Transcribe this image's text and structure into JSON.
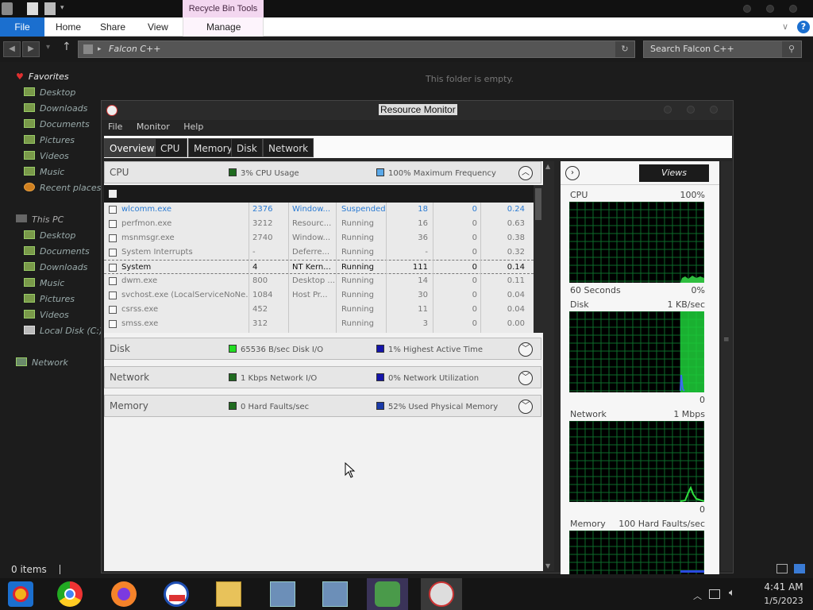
{
  "explorer": {
    "contextual_tab": "Recycle Bin Tools",
    "ribbon": {
      "file": "File",
      "home": "Home",
      "share": "Share",
      "view": "View",
      "manage": "Manage"
    },
    "address": "Falcon C++",
    "search_placeholder": "Search Falcon C++",
    "empty_message": "This folder is empty.",
    "status": "0 items",
    "nav": {
      "favorites": "Favorites",
      "fav_items": [
        "Desktop",
        "Downloads",
        "Documents",
        "Pictures",
        "Videos",
        "Music",
        "Recent places"
      ],
      "this_pc": "This PC",
      "pc_items": [
        "Desktop",
        "Documents",
        "Downloads",
        "Music",
        "Pictures",
        "Videos",
        "Local Disk (C:)"
      ],
      "network": "Network"
    }
  },
  "resmon": {
    "title": "Resource Monitor",
    "menu": [
      "File",
      "Monitor",
      "Help"
    ],
    "tabs": [
      "Overview",
      "CPU",
      "Memory",
      "Disk",
      "Network"
    ],
    "sections": {
      "cpu": {
        "name": "CPU",
        "ind1": "3% CPU Usage",
        "ind2": "100% Maximum Frequency",
        "ind1_color": "#1f6b1f",
        "ind2_color": "#5aa8e8"
      },
      "disk": {
        "name": "Disk",
        "ind1": "65536 B/sec Disk I/O",
        "ind2": "1% Highest Active Time",
        "ind1_color": "#22dd22",
        "ind2_color": "#1515aa"
      },
      "network": {
        "name": "Network",
        "ind1": "1 Kbps Network I/O",
        "ind2": "0% Network Utilization",
        "ind1_color": "#1f6b1f",
        "ind2_color": "#1515aa"
      },
      "memory": {
        "name": "Memory",
        "ind1": "0 Hard Faults/sec",
        "ind2": "52% Used Physical Memory",
        "ind1_color": "#1f6b1f",
        "ind2_color": "#1a3aa8"
      }
    },
    "processes": [
      {
        "name": "wlcomm.exe",
        "pid": "2376",
        "desc": "Window...",
        "status": "Suspended",
        "threads": "18",
        "cpu": "0",
        "avg": "0.24"
      },
      {
        "name": "perfmon.exe",
        "pid": "3212",
        "desc": "Resourc...",
        "status": "Running",
        "threads": "16",
        "cpu": "0",
        "avg": "0.63"
      },
      {
        "name": "msnmsgr.exe",
        "pid": "2740",
        "desc": "Window...",
        "status": "Running",
        "threads": "36",
        "cpu": "0",
        "avg": "0.38"
      },
      {
        "name": "System Interrupts",
        "pid": "-",
        "desc": "Deferre...",
        "status": "Running",
        "threads": "-",
        "cpu": "0",
        "avg": "0.32"
      },
      {
        "name": "System",
        "pid": "4",
        "desc": "NT Kern...",
        "status": "Running",
        "threads": "111",
        "cpu": "0",
        "avg": "0.14"
      },
      {
        "name": "dwm.exe",
        "pid": "800",
        "desc": "Desktop ...",
        "status": "Running",
        "threads": "14",
        "cpu": "0",
        "avg": "0.11"
      },
      {
        "name": "svchost.exe (LocalServiceNoNe...",
        "pid": "1084",
        "desc": "Host Pr...",
        "status": "Running",
        "threads": "30",
        "cpu": "0",
        "avg": "0.04"
      },
      {
        "name": "csrss.exe",
        "pid": "452",
        "desc": "",
        "status": "Running",
        "threads": "11",
        "cpu": "0",
        "avg": "0.04"
      },
      {
        "name": "smss.exe",
        "pid": "312",
        "desc": "",
        "status": "Running",
        "threads": "3",
        "cpu": "0",
        "avg": "0.00"
      }
    ],
    "views_label": "Views",
    "graphs": {
      "cpu": {
        "label": "CPU",
        "max": "100%",
        "footer_left": "60 Seconds",
        "footer_right": "0%"
      },
      "disk": {
        "label": "Disk",
        "max": "1 KB/sec",
        "footer_right": "0"
      },
      "network": {
        "label": "Network",
        "max": "1 Mbps",
        "footer_right": "0"
      },
      "memory": {
        "label": "Memory",
        "max": "100 Hard Faults/sec"
      }
    }
  },
  "taskbar": {
    "time": "4:41 AM",
    "date": "1/5/2023"
  }
}
